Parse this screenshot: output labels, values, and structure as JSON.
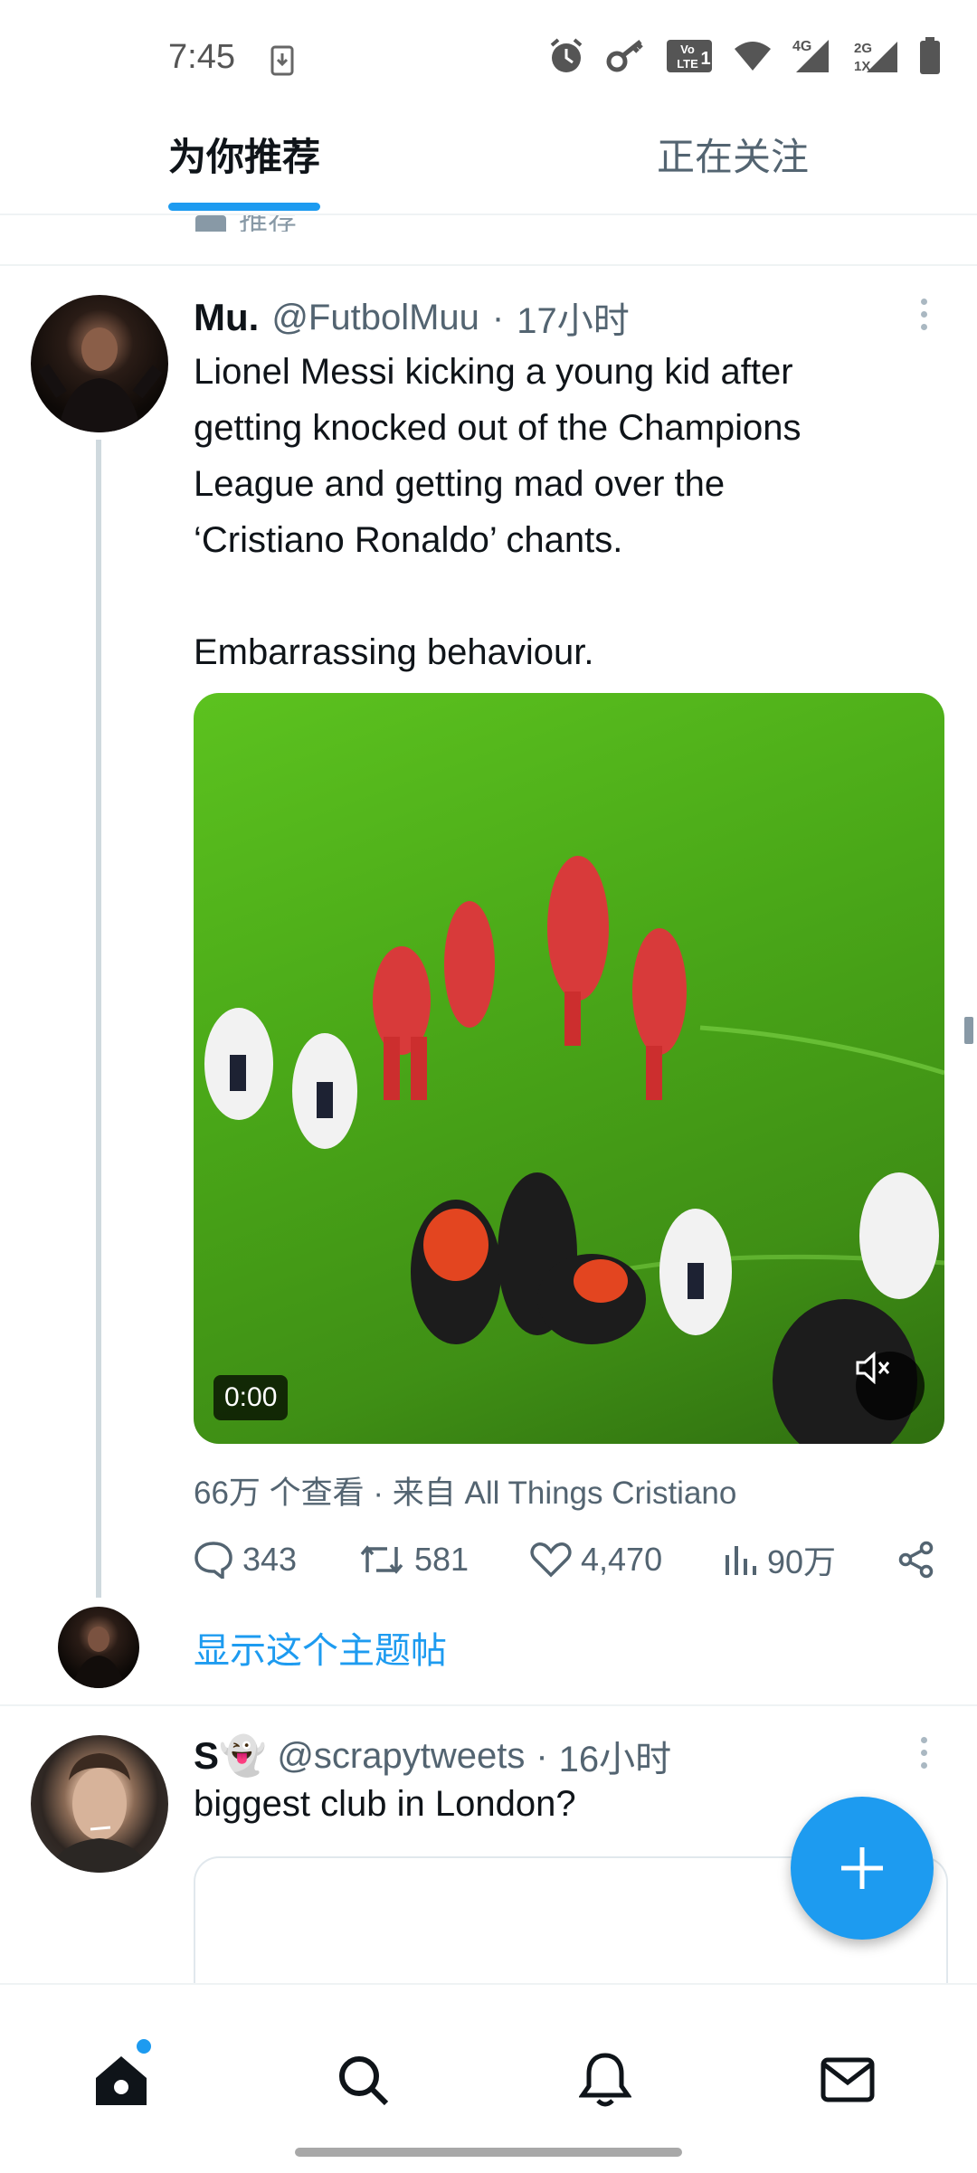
{
  "status_bar": {
    "time": "7:45",
    "icons": [
      "download-icon",
      "alarm-icon",
      "key-icon",
      "volte-icon",
      "wifi-icon",
      "signal-4g-icon",
      "signal-2g-icon",
      "battery-icon"
    ],
    "network_4g": "4G",
    "network_2g": "2G",
    "network_1x": "1X",
    "volte": "Vo LTE"
  },
  "tabs": [
    {
      "label": "为你推荐",
      "selected": true
    },
    {
      "label": "正在关注",
      "selected": false
    }
  ],
  "peek": {
    "label": "推荐"
  },
  "tweets": [
    {
      "name": "Mu.",
      "handle": "@FutbolMuu",
      "separator": "·",
      "time": "17小时",
      "text": "Lionel Messi kicking a young kid after\ngetting knocked out of the Champions\nLeague and getting mad over the\n‘Cristiano Ronaldo’ chants.\n\nEmbarrassing behaviour.",
      "video": {
        "timestamp": "0:00",
        "muted": true
      },
      "meta": "66万 个查看  ·  来自 All Things Cristiano",
      "actions": {
        "replies": "343",
        "retweets": "581",
        "likes": "4,470",
        "views": "90万"
      },
      "show_thread": "显示这个主题帖"
    },
    {
      "name": "S👻",
      "handle": "@scrapytweets",
      "separator": "·",
      "time": "16小时",
      "text": "biggest club in London?"
    }
  ],
  "bottom_nav": {
    "items": [
      "home-icon",
      "search-icon",
      "notifications-icon",
      "messages-icon"
    ],
    "home_has_badge": true
  },
  "colors": {
    "accent": "#1d9bf0",
    "text": "#0f1419",
    "secondary": "#536471"
  }
}
